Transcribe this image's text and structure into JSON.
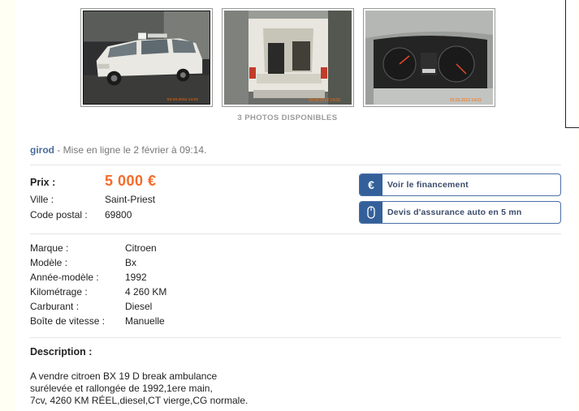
{
  "photos": {
    "count_label": "3 PHOTOS DISPONIBLES",
    "items": [
      {
        "alt": "Citroen BX break ambulance",
        "stamp": "03.03.2012 14:02"
      },
      {
        "alt": "Rear cargo area",
        "stamp": "03.03.2012 14:03"
      },
      {
        "alt": "Dashboard odometer",
        "stamp": "03.03.2012 14:03"
      }
    ]
  },
  "poster": {
    "seller": "girod",
    "posted": " - Mise en ligne le 2 février à 09:14."
  },
  "price_block": {
    "price_label": "Prix :",
    "price": "5 000 €",
    "city_label": "Ville :",
    "city": "Saint-Priest",
    "zip_label": "Code postal :",
    "zip": "69800"
  },
  "buttons": {
    "financing": {
      "icon": "euro-icon",
      "symbol": "€",
      "label": "Voir le financement"
    },
    "insurance": {
      "icon": "mouse-icon",
      "label": "Devis d'assurance auto en 5 mn"
    }
  },
  "specs": [
    {
      "label": "Marque :",
      "value": "Citroen"
    },
    {
      "label": "Modèle :",
      "value": "Bx"
    },
    {
      "label": "Année-modèle :",
      "value": "1992"
    },
    {
      "label": "Kilométrage :",
      "value": "4 260 KM"
    },
    {
      "label": "Carburant :",
      "value": "Diesel"
    },
    {
      "label": "Boîte de vitesse :",
      "value": "Manuelle"
    }
  ],
  "description": {
    "title": "Description :",
    "lines": [
      "A vendre citroen BX 19 D break ambulance",
      "surélevée et rallongée de 1992,1ere main,",
      "7cv, 4260 KM RÉEL,diesel,CT vierge,CG normale."
    ]
  },
  "colors": {
    "price": "#f56b2a",
    "seller_link": "#4a6d9c",
    "button_icon_bg": "#33609a",
    "page_bg": "#fffff3"
  }
}
